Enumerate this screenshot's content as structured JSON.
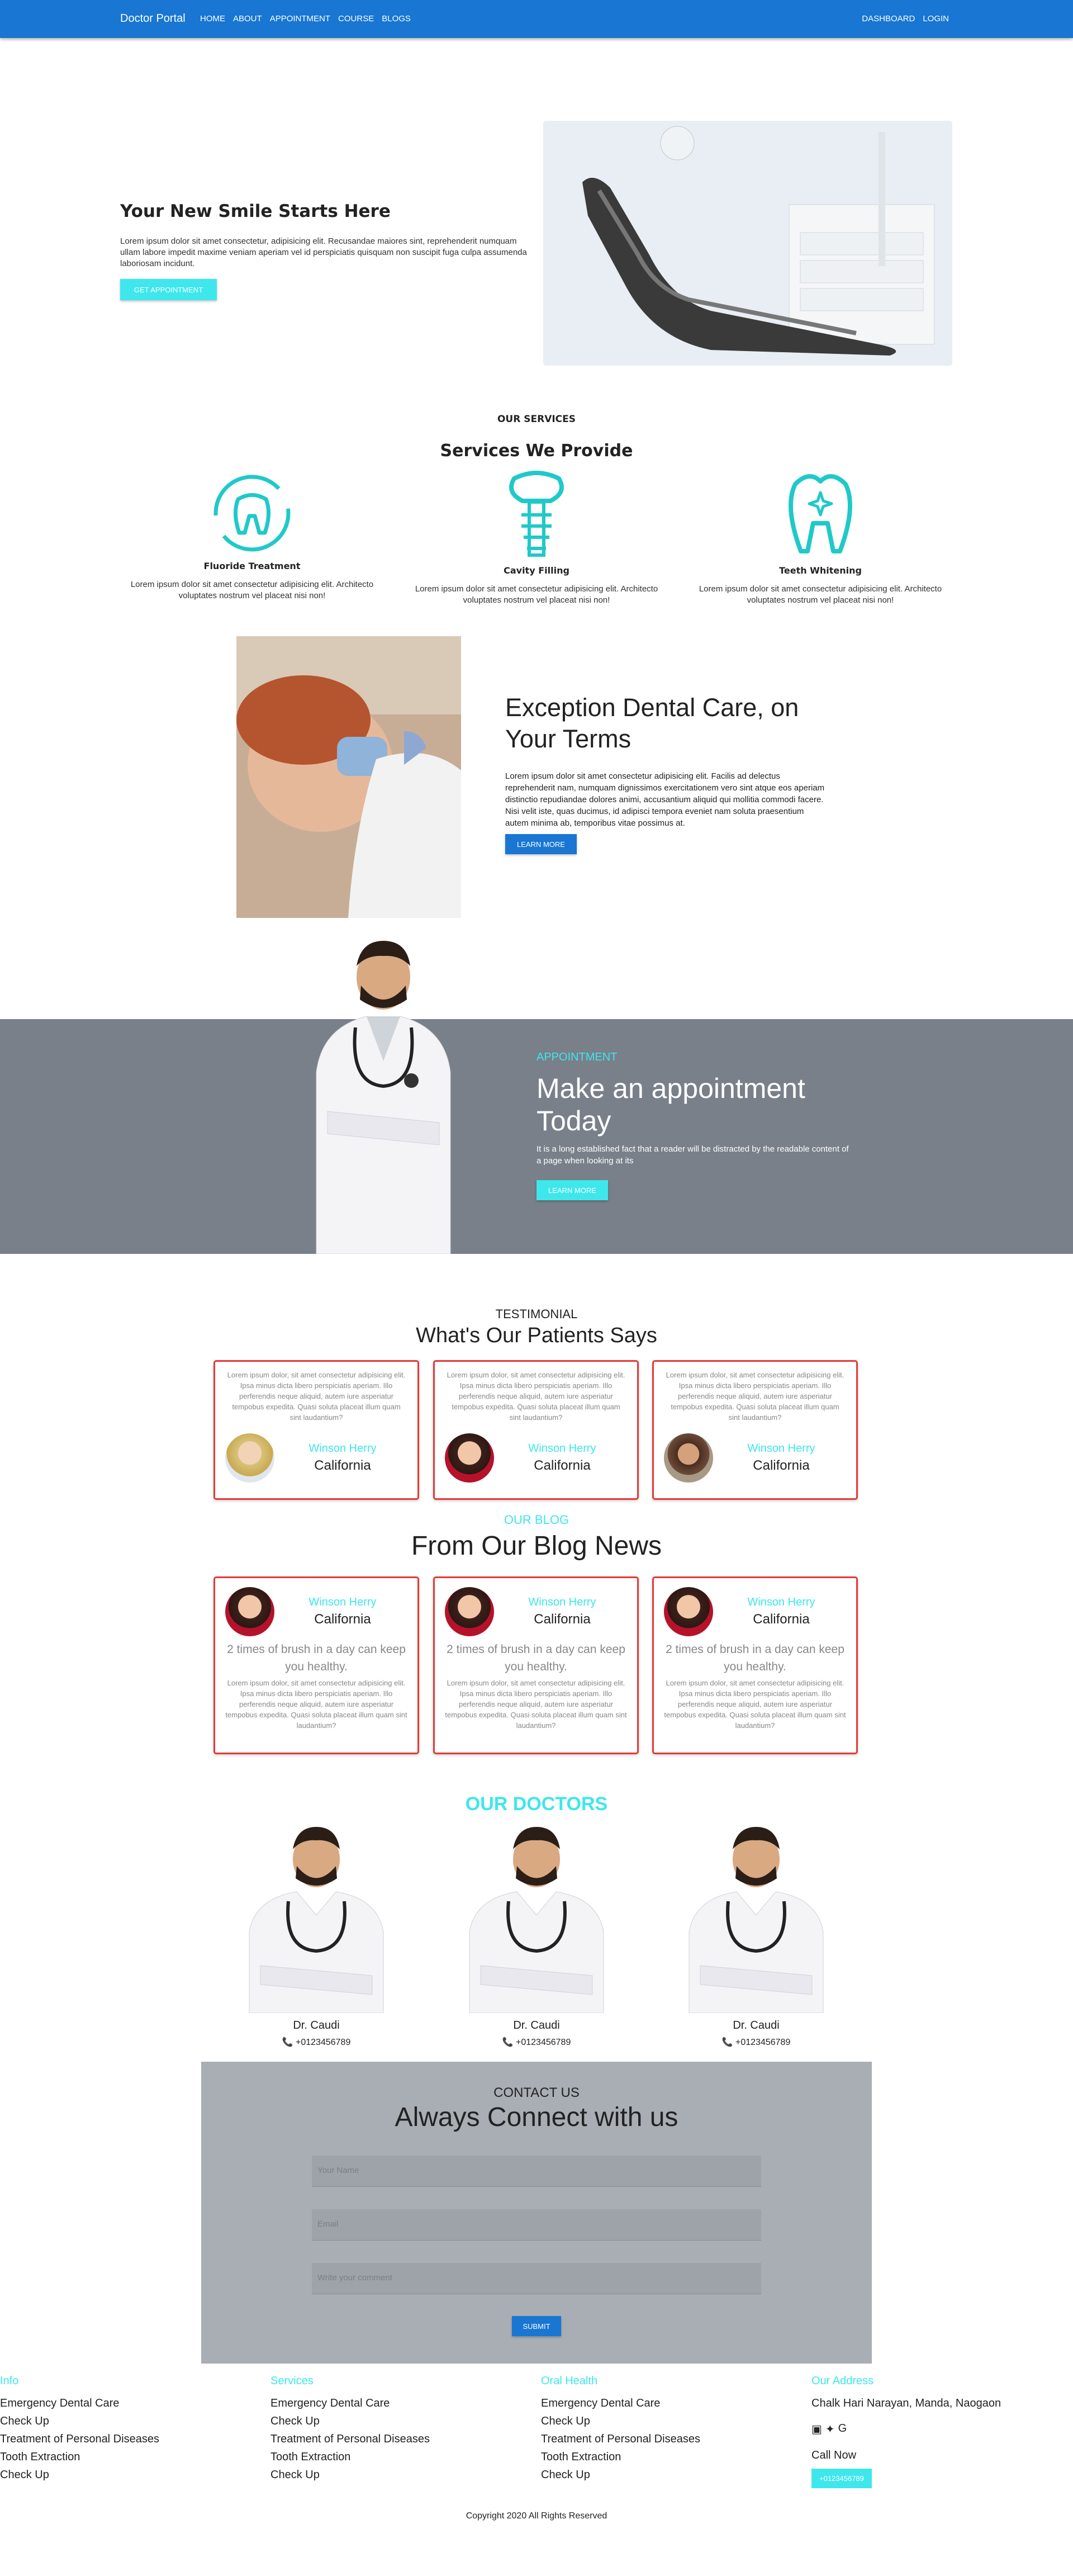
{
  "navbar": {
    "brand": "Doctor Portal",
    "links": [
      "HOME",
      "ABOUT",
      "APPOINTMENT",
      "COURSE",
      "BLOGS"
    ],
    "right_links": [
      "DASHBOARD",
      "LOGIN"
    ],
    "color": "#1976d2"
  },
  "hero": {
    "title": "Your New Smile Starts Here",
    "text": "Lorem ipsum dolor sit amet consectetur, adipisicing elit. Recusandae maiores sint, reprehenderit numquam ullam labore impedit maxime veniam aperiam vel id perspiciatis quisquam non suscipit fuga culpa assumenda laboriosam incidunt.",
    "button": "GET APPOINTMENT"
  },
  "services": {
    "eyebrow": "OUR SERVICES",
    "title": "Services We Provide",
    "items": [
      {
        "name": "Fluoride Treatment",
        "text": "Lorem ipsum dolor sit amet consectetur adipisicing elit. Architecto voluptates nostrum vel placeat nisi non!",
        "icon": "fluoride-tooth-icon"
      },
      {
        "name": "Cavity Filling",
        "text": "Lorem ipsum dolor sit amet consectetur adipisicing elit. Architecto voluptates nostrum vel placeat nisi non!",
        "icon": "dental-implant-icon"
      },
      {
        "name": "Teeth Whitening",
        "text": "Lorem ipsum dolor sit amet consectetur adipisicing elit. Architecto voluptates nostrum vel placeat nisi non!",
        "icon": "whitening-tooth-icon"
      }
    ]
  },
  "exception": {
    "title": "Exception Dental Care, on Your Terms",
    "text": "Lorem ipsum dolor sit amet consectetur adipisicing elit. Facilis ad delectus reprehenderit nam, numquam dignissimos exercitationem vero sint atque eos aperiam distinctio repudiandae dolores animi, accusantium aliquid qui mollitia commodi facere. Nisi velit iste, quas ducimus, id adipisci tempora eveniet nam soluta praesentium autem minima ab, temporibus vitae possimus at.",
    "button": "LEARN MORE"
  },
  "appointment": {
    "eyebrow": "APPOINTMENT",
    "title": "Make an appointment Today",
    "text": "It is a long established fact that a reader will be distracted by the readable content of a page when looking at its",
    "button": "LEARN MORE"
  },
  "testimonial": {
    "eyebrow": "TESTIMONIAL",
    "title": "What's Our Patients Says",
    "cards": [
      {
        "text": "Lorem ipsum dolor, sit amet consectetur adipisicing elit. Ipsa minus dicta libero perspiciatis aperiam. Illo perferendis neque aliquid, autem iure asperiatur tempobus expedita. Quasi soluta placeat illum quam sint laudantium?",
        "name": "Winson Herry",
        "location": "California"
      },
      {
        "text": "Lorem ipsum dolor, sit amet consectetur adipisicing elit. Ipsa minus dicta libero perspiciatis aperiam. Illo perferendis neque aliquid, autem iure asperiatur tempobus expedita. Quasi soluta placeat illum quam sint laudantium?",
        "name": "Winson Herry",
        "location": "California"
      },
      {
        "text": "Lorem ipsum dolor, sit amet consectetur adipisicing elit. Ipsa minus dicta libero perspiciatis aperiam. Illo perferendis neque aliquid, autem iure asperiatur tempobus expedita. Quasi soluta placeat illum quam sint laudantium?",
        "name": "Winson Herry",
        "location": "California"
      }
    ]
  },
  "blog": {
    "eyebrow": "OUR BLOG",
    "title": "From Our Blog News",
    "cards": [
      {
        "name": "Winson Herry",
        "location": "California",
        "headline": "2 times of brush in a day can keep you healthy.",
        "text": "Lorem ipsum dolor, sit amet consectetur adipisicing elit. Ipsa minus dicta libero perspiciatis aperiam. Illo perferendis neque aliquid, autem iure asperiatur tempobus expedita. Quasi soluta placeat illum quam sint laudantium?"
      },
      {
        "name": "Winson Herry",
        "location": "California",
        "headline": "2 times of brush in a day can keep you healthy.",
        "text": "Lorem ipsum dolor, sit amet consectetur adipisicing elit. Ipsa minus dicta libero perspiciatis aperiam. Illo perferendis neque aliquid, autem iure asperiatur tempobus expedita. Quasi soluta placeat illum quam sint laudantium?"
      },
      {
        "name": "Winson Herry",
        "location": "California",
        "headline": "2 times of brush in a day can keep you healthy.",
        "text": "Lorem ipsum dolor, sit amet consectetur adipisicing elit. Ipsa minus dicta libero perspiciatis aperiam. Illo perferendis neque aliquid, autem iure asperiatur tempobus expedita. Quasi soluta placeat illum quam sint laudantium?"
      }
    ]
  },
  "doctors": {
    "title": "OUR DOCTORS",
    "items": [
      {
        "name": "Dr. Caudi",
        "phone": "+0123456789"
      },
      {
        "name": "Dr. Caudi",
        "phone": "+0123456789"
      },
      {
        "name": "Dr. Caudi",
        "phone": "+0123456789"
      }
    ]
  },
  "contact": {
    "eyebrow": "CONTACT US",
    "title": "Always Connect with us",
    "name_placeholder": "Your Name",
    "email_placeholder": "Email",
    "comment_placeholder": "Write your comment",
    "button": "SUBMIT"
  },
  "footer": {
    "info": {
      "heading": "Info",
      "items": [
        "Emergency Dental Care",
        "Check Up",
        "Treatment of Personal Diseases",
        "Tooth Extraction",
        "Check Up"
      ]
    },
    "services": {
      "heading": "Services",
      "items": [
        "Emergency Dental Care",
        "Check Up",
        "Treatment of Personal Diseases",
        "Tooth Extraction",
        "Check Up"
      ]
    },
    "oral": {
      "heading": "Oral Health",
      "items": [
        "Emergency Dental Care",
        "Check Up",
        "Treatment of Personal Diseases",
        "Tooth Extraction",
        "Check Up"
      ]
    },
    "address": {
      "heading": "Our Address",
      "line": "Chalk Hari Narayan, Manda, Naogaon",
      "call_label": "Call Now",
      "phone": "+0123456789"
    },
    "copyright": "Copyright 2020 All Rights Reserved"
  },
  "colors": {
    "accent": "#3ee7ec",
    "primary": "#1976d2",
    "card_border": "#e53935"
  }
}
